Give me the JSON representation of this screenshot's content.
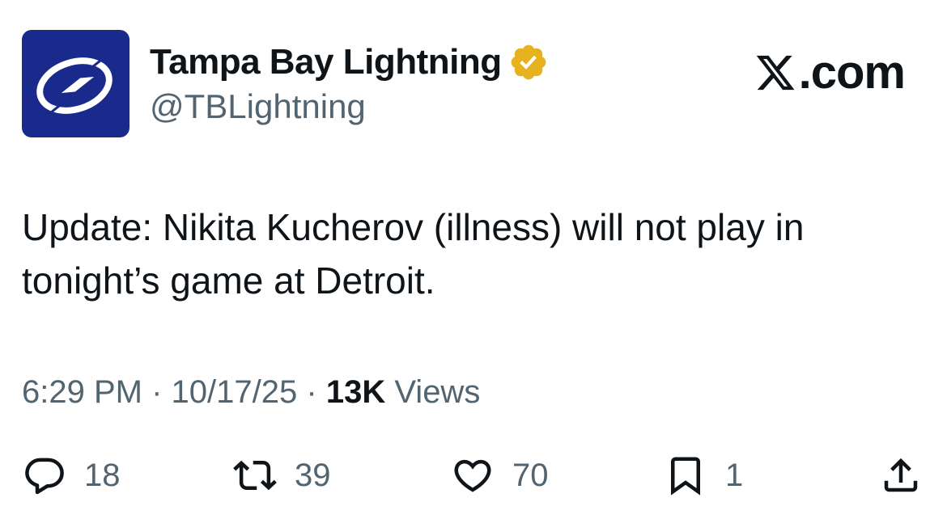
{
  "account": {
    "display_name": "Tampa Bay Lightning",
    "handle": "@TBLightning",
    "verified_icon": "verified-badge-gold",
    "avatar_icon": "lightning-bolt-logo",
    "brand_color": "#1a2a8c"
  },
  "source": {
    "label": ".com",
    "icon": "x-logo"
  },
  "tweet": {
    "text": "Update: Nikita Kucherov (illness) will not play in tonight’s game at Detroit."
  },
  "meta": {
    "time": "6:29 PM",
    "separator": "·",
    "date": "10/17/25",
    "views_count": "13K",
    "views_label": "Views"
  },
  "actions": {
    "replies": "18",
    "reposts": "39",
    "likes": "70",
    "bookmarks": "1"
  },
  "colors": {
    "text": "#0f1419",
    "secondary": "#536471",
    "verified": "#e8b21f"
  }
}
